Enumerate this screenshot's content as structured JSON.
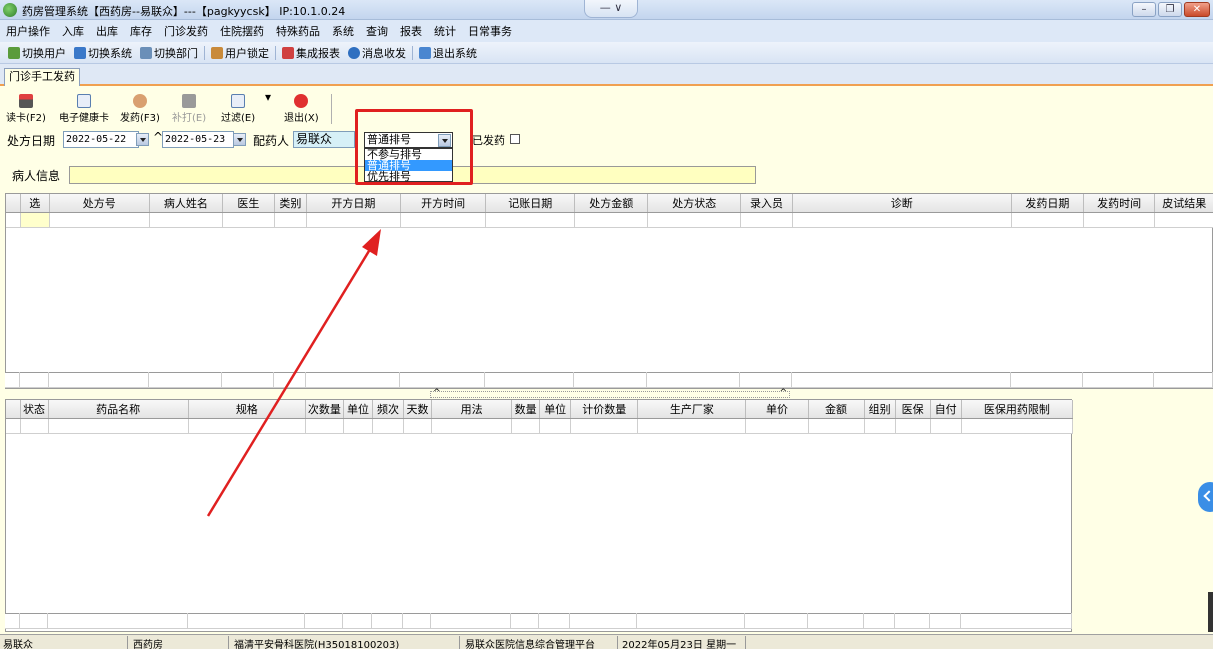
{
  "window": {
    "title": "药房管理系统【西药房--易联众】---【pagkyycsk】 IP:10.1.0.24",
    "mid_control": "— ∨"
  },
  "menu": [
    "用户操作",
    "入库",
    "出库",
    "库存",
    "门诊发药",
    "住院摆药",
    "特殊药品",
    "系统",
    "查询",
    "报表",
    "统计",
    "日常事务"
  ],
  "toolbar": {
    "switch_user": "切换用户",
    "switch_system": "切换系统",
    "switch_dept": "切换部门",
    "user_lock": "用户锁定",
    "integrated_report": "集成报表",
    "message": "消息收发",
    "exit_system": "退出系统"
  },
  "tab": {
    "label": "门诊手工发药"
  },
  "actions": {
    "read_card": "读卡(F2)",
    "e_health_card": "电子健康卡",
    "dispense": "发药(F3)",
    "reprint": "补打(E)",
    "filter": "过滤(E)",
    "exit": "退出(X)"
  },
  "filters": {
    "rx_date_label": "处方日期",
    "date_from": "2022-05-22",
    "date_sep": "^",
    "date_to": "2022-05-23",
    "pharmacist_label": "配药人",
    "pharmacist_value": "易联众",
    "queue_selected": "普通排号",
    "queue_options": [
      "不参与排号",
      "普通排号",
      "优先排号"
    ],
    "dispensed_label": "已发药"
  },
  "patient": {
    "label": "病人信息",
    "value": ""
  },
  "rx_table": {
    "columns": [
      "选",
      "处方号",
      "病人姓名",
      "医生",
      "类别",
      "开方日期",
      "开方时间",
      "记账日期",
      "处方金额",
      "处方状态",
      "录入员",
      "诊断",
      "发药日期",
      "发药时间",
      "皮试结果"
    ]
  },
  "drug_table": {
    "columns": [
      "状态",
      "药品名称",
      "规格",
      "次数量",
      "单位",
      "频次",
      "天数",
      "用法",
      "数量",
      "单位",
      "计价数量",
      "生产厂家",
      "单价",
      "金额",
      "组别",
      "医保",
      "自付",
      "医保用药限制"
    ]
  },
  "statusbar": {
    "user": "易联众",
    "dept": "西药房",
    "hospital": "福清平安骨科医院(H35018100203)",
    "platform": "易联众医院信息综合管理平台",
    "date": "2022年05月23日 星期一"
  },
  "colors": {
    "annotation_red": "#e02020",
    "selected_option": "#3399ff",
    "pharmacist_bg": "#d6f0f7",
    "patient_bg": "#ffffc0",
    "window_bg": "#ffffe6"
  }
}
